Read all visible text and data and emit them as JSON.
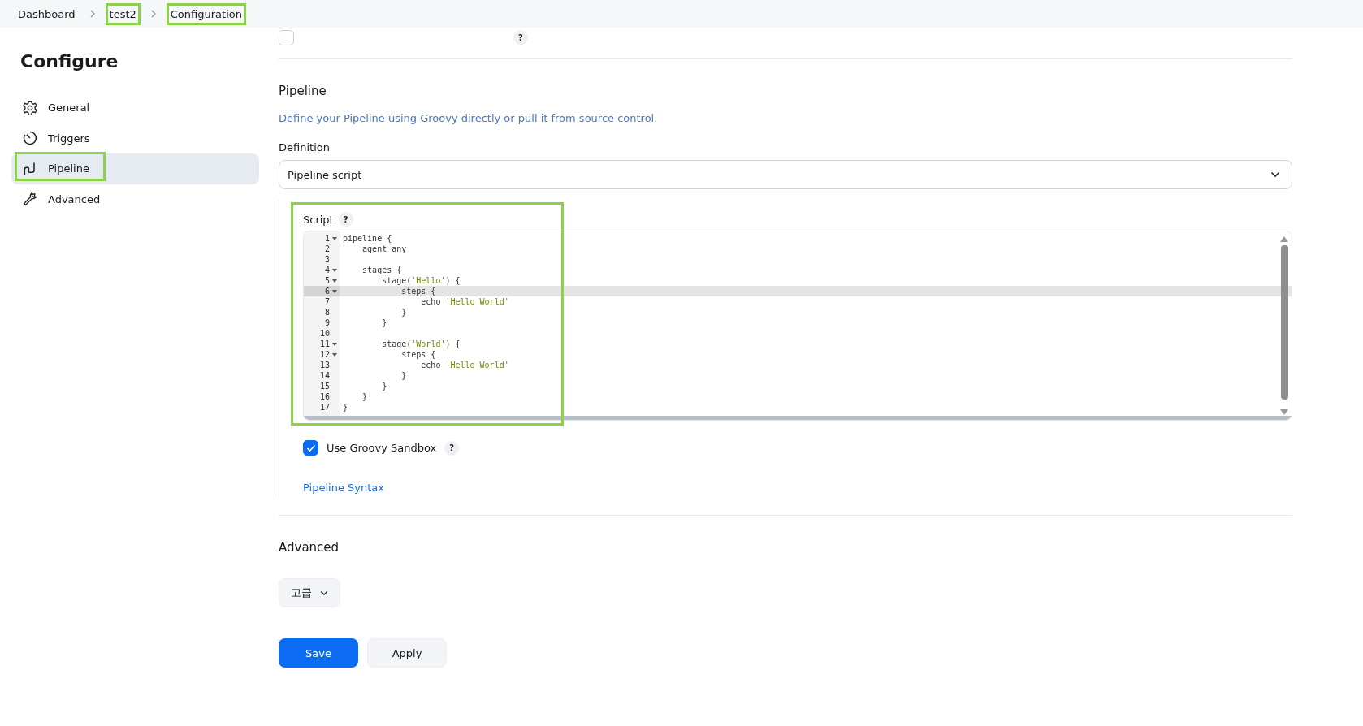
{
  "breadcrumb": [
    {
      "label": "Dashboard",
      "highlighted": false
    },
    {
      "label": "test2",
      "highlighted": true
    },
    {
      "label": "Configuration",
      "highlighted": true
    }
  ],
  "top_option": {
    "checked": false,
    "help": "?"
  },
  "sidebar": {
    "title": "Configure",
    "items": [
      {
        "label": "General",
        "selected": false,
        "highlighted": false
      },
      {
        "label": "Triggers",
        "selected": false,
        "highlighted": false
      },
      {
        "label": "Pipeline",
        "selected": true,
        "highlighted": true
      },
      {
        "label": "Advanced",
        "selected": false,
        "highlighted": false
      }
    ]
  },
  "pipeline": {
    "title": "Pipeline",
    "description": "Define your Pipeline using Groovy directly or pull it from source control.",
    "definition_label": "Definition",
    "definition_value": "Pipeline script",
    "script": {
      "label": "Script",
      "help": "?",
      "highlighted": true,
      "lines": [
        {
          "n": "1",
          "fold": true,
          "active": false,
          "parts": [
            {
              "kind": "plain",
              "text": "pipeline {"
            }
          ]
        },
        {
          "n": "2",
          "fold": false,
          "active": false,
          "parts": [
            {
              "kind": "plain",
              "text": "    agent any"
            }
          ]
        },
        {
          "n": "3",
          "fold": false,
          "active": false
        },
        {
          "n": "4",
          "fold": true,
          "active": false,
          "parts": [
            {
              "kind": "plain",
              "text": "    stages {"
            }
          ]
        },
        {
          "n": "5",
          "fold": true,
          "active": false,
          "parts": [
            {
              "kind": "plain",
              "text": "        stage("
            },
            {
              "kind": "string",
              "text": "'Hello'"
            },
            {
              "kind": "plain",
              "text": ") {"
            }
          ]
        },
        {
          "n": "6",
          "fold": true,
          "active": true,
          "parts": [
            {
              "kind": "plain",
              "text": "            steps {"
            }
          ]
        },
        {
          "n": "7",
          "fold": false,
          "active": false,
          "parts": [
            {
              "kind": "plain",
              "text": "                echo "
            },
            {
              "kind": "string",
              "text": "'Hello World'"
            }
          ]
        },
        {
          "n": "8",
          "fold": false,
          "active": false,
          "parts": [
            {
              "kind": "plain",
              "text": "            }"
            }
          ]
        },
        {
          "n": "9",
          "fold": false,
          "active": false,
          "parts": [
            {
              "kind": "plain",
              "text": "        }"
            }
          ]
        },
        {
          "n": "10",
          "fold": false,
          "active": false
        },
        {
          "n": "11",
          "fold": true,
          "active": false,
          "parts": [
            {
              "kind": "plain",
              "text": "        stage("
            },
            {
              "kind": "string",
              "text": "'World'"
            },
            {
              "kind": "plain",
              "text": ") {"
            }
          ]
        },
        {
          "n": "12",
          "fold": true,
          "active": false,
          "parts": [
            {
              "kind": "plain",
              "text": "            steps {"
            }
          ]
        },
        {
          "n": "13",
          "fold": false,
          "active": false,
          "parts": [
            {
              "kind": "plain",
              "text": "                echo "
            },
            {
              "kind": "string",
              "text": "'Hello World'"
            }
          ]
        },
        {
          "n": "14",
          "fold": false,
          "active": false,
          "parts": [
            {
              "kind": "plain",
              "text": "            }"
            }
          ]
        },
        {
          "n": "15",
          "fold": false,
          "active": false,
          "parts": [
            {
              "kind": "plain",
              "text": "        }"
            }
          ]
        },
        {
          "n": "16",
          "fold": false,
          "active": false,
          "parts": [
            {
              "kind": "plain",
              "text": "    }"
            }
          ]
        },
        {
          "n": "17",
          "fold": false,
          "active": false,
          "parts": [
            {
              "kind": "plain",
              "text": "}"
            }
          ]
        }
      ]
    },
    "sandbox": {
      "label": "Use Groovy Sandbox",
      "checked": true,
      "help": "?"
    },
    "syntax_link": "Pipeline Syntax"
  },
  "advanced": {
    "title": "Advanced",
    "button": "고급"
  },
  "buttons": [
    {
      "label": "Save",
      "kind": "primary"
    },
    {
      "label": "Apply",
      "kind": "secondary"
    }
  ]
}
